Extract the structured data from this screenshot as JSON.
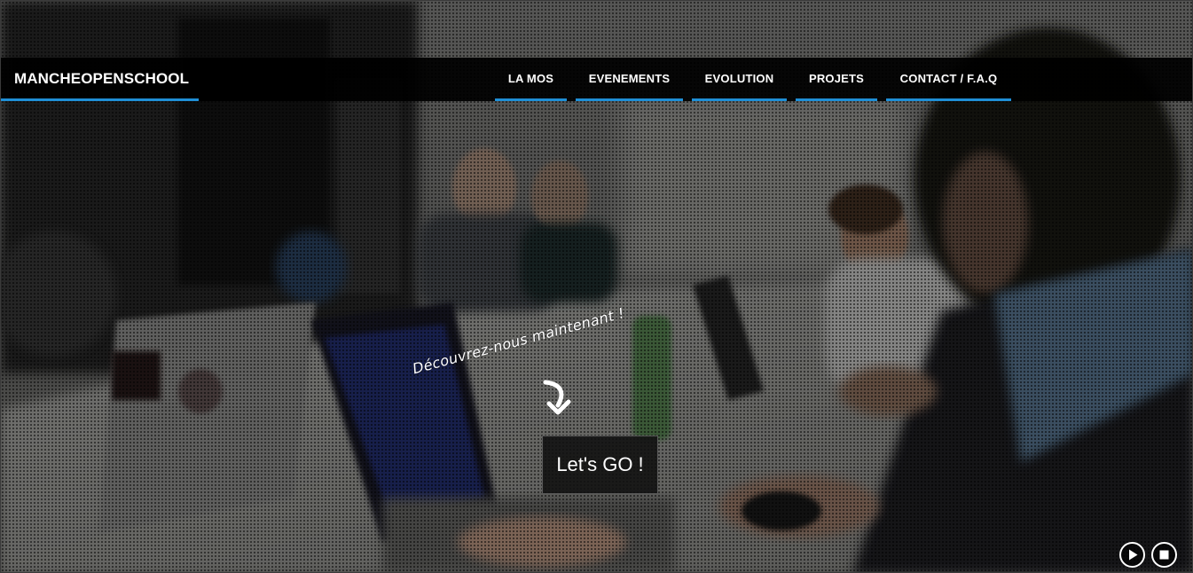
{
  "brand": {
    "name": "MANCHEOPENSCHOOL"
  },
  "nav": {
    "items": [
      {
        "label": "LA MOS"
      },
      {
        "label": "EVENEMENTS"
      },
      {
        "label": "EVOLUTION"
      },
      {
        "label": "PROJETS"
      },
      {
        "label": "CONTACT / F.A.Q"
      }
    ]
  },
  "hero": {
    "tagline": "Découvrez-nous maintenant !",
    "cta_label": "Let's GO !",
    "background": "photo of people working on laptops around a table"
  },
  "slideshow": {
    "controls": [
      {
        "icon": "play-icon"
      },
      {
        "icon": "stop-icon"
      }
    ]
  },
  "colors": {
    "accent": "#1f8fd6",
    "navbar": "#000000",
    "text": "#ffffff"
  }
}
